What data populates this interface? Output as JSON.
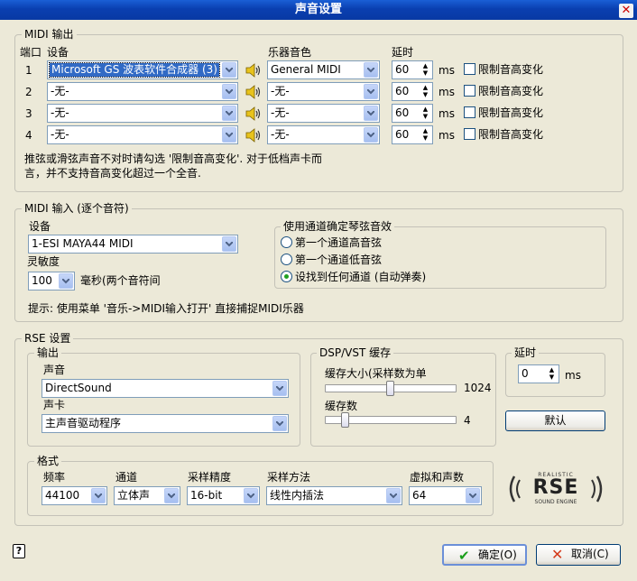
{
  "window": {
    "title": "声音设置"
  },
  "midi_out": {
    "group": "MIDI 输出",
    "col_port": "端口",
    "col_device": "设备",
    "col_instrument": "乐器音色",
    "col_delay": "延时",
    "ms": "ms",
    "limit_label": "限制音高变化",
    "rows": [
      {
        "port": "1",
        "device": "Microsoft GS 波表软件合成器 (3)",
        "instrument": "General MIDI",
        "delay": "60"
      },
      {
        "port": "2",
        "device": "-无-",
        "instrument": "-无-",
        "delay": "60"
      },
      {
        "port": "3",
        "device": "-无-",
        "instrument": "-无-",
        "delay": "60"
      },
      {
        "port": "4",
        "device": "-无-",
        "instrument": "-无-",
        "delay": "60"
      }
    ],
    "note_line1": "推弦或滑弦声音不对时请勾选 '限制音高变化'. 对于低档声卡而",
    "note_line2": "言，并不支持音高变化超过一个全音."
  },
  "midi_in": {
    "group": "MIDI 输入 (逐个音符)",
    "device_label": "设备",
    "device_value": "1-ESI MAYA44 MIDI",
    "sens_label": "灵敏度",
    "sens_value": "100",
    "sens_unit": "毫秒(两个音符间",
    "channel_group": "使用通道确定琴弦音效",
    "radios": [
      "第一个通道高音弦",
      "第一个通道低音弦",
      "设找到任何通道 (自动弹奏)"
    ],
    "hint": "提示: 使用菜单 '音乐->MIDI输入打开' 直接捕捉MIDI乐器"
  },
  "rse": {
    "group": "RSE 设置",
    "output_group": "输出",
    "sound_label": "声音",
    "sound_value": "DirectSound",
    "card_label": "声卡",
    "card_value": "主声音驱动程序",
    "dsp_group": "DSP/VST 缓存",
    "buf_size_label": "缓存大小(采样数为单",
    "buf_size_value": "1024",
    "buf_count_label": "缓存数",
    "buf_count_value": "4",
    "delay_group": "延时",
    "delay_value": "0",
    "delay_unit": "ms",
    "default_button": "默认",
    "format_group": "格式",
    "freq_label": "频率",
    "freq_value": "44100",
    "channel_label": "通道",
    "channel_value": "立体声",
    "precision_label": "采样精度",
    "precision_value": "16-bit",
    "method_label": "采样方法",
    "method_value": "线性内插法",
    "virtual_label": "虚拟和声数",
    "virtual_value": "64",
    "logo_top": "REALISTIC",
    "logo_main": "RSE",
    "logo_bottom": "SOUND ENGINE"
  },
  "footer": {
    "help": "?",
    "ok": "确定(O)",
    "cancel": "取消(C)"
  }
}
